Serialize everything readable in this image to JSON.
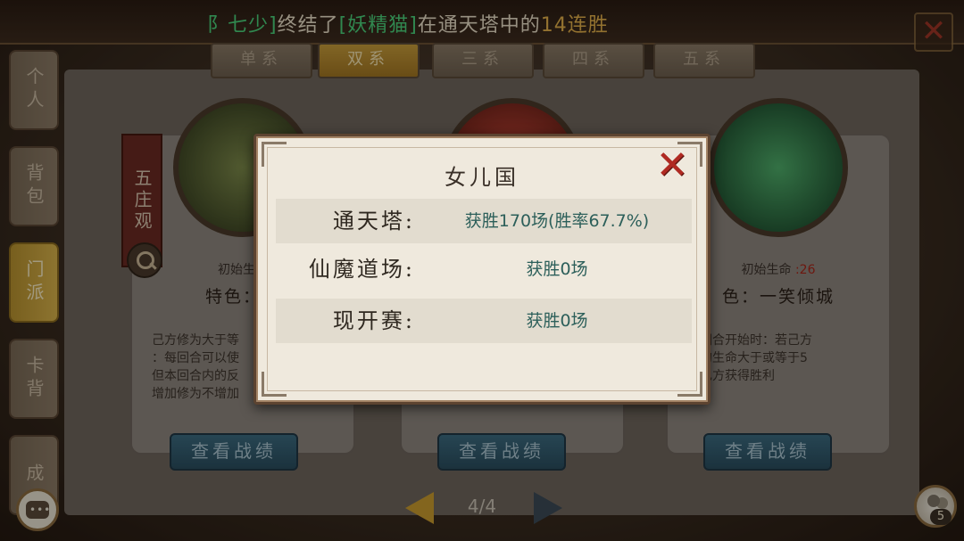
{
  "ticker": {
    "name": "阝七少]",
    "verb": "终结了",
    "target": "[妖精猫]",
    "middle": "在通天塔中的",
    "streak": "14连胜"
  },
  "side_tabs": [
    {
      "label": "个人",
      "active": false
    },
    {
      "label": "背包",
      "active": false
    },
    {
      "label": "门派",
      "active": true
    },
    {
      "label": "卡背",
      "active": false
    },
    {
      "label": "成",
      "active": false
    }
  ],
  "top_tabs": [
    {
      "label": "单系",
      "active": false
    },
    {
      "label": "双系",
      "active": true
    },
    {
      "label": "三系",
      "active": false
    },
    {
      "label": "四系",
      "active": false
    },
    {
      "label": "五系",
      "active": false
    }
  ],
  "cards": [
    {
      "hp_label": "初始生命",
      "hp_value": "",
      "feature": "特色：基",
      "desc": "己方修为大于等\n：每回合可以使\n但本回合内的反\n增加修为不增加",
      "record_button": "查看战绩"
    },
    {
      "hp_label": "",
      "hp_value": "",
      "feature": "",
      "desc": "",
      "record_button": "查看战绩"
    },
    {
      "hp_label": "初始生命",
      "hp_value": ":26",
      "feature": "色：一笑倾城",
      "desc": "方回合开始时：若己方\n角的生命大于或等于5\n则己方获得胜利",
      "record_button": "查看战绩"
    }
  ],
  "sect_banner": "五庄观",
  "pager": {
    "text": "4/4"
  },
  "friends_count": "5",
  "modal": {
    "title": "女儿国",
    "rows": [
      {
        "label": "通天塔:",
        "value": "获胜170场(胜率67.7%)"
      },
      {
        "label": "仙魔道场:",
        "value": "获胜0场"
      },
      {
        "label": "现开赛:",
        "value": "获胜0场"
      }
    ]
  },
  "colors": {
    "accent_gold": "#c99b2f",
    "win_text": "#2c5f5a",
    "close_red": "#b02a22",
    "player_green": "#4bd07a"
  }
}
